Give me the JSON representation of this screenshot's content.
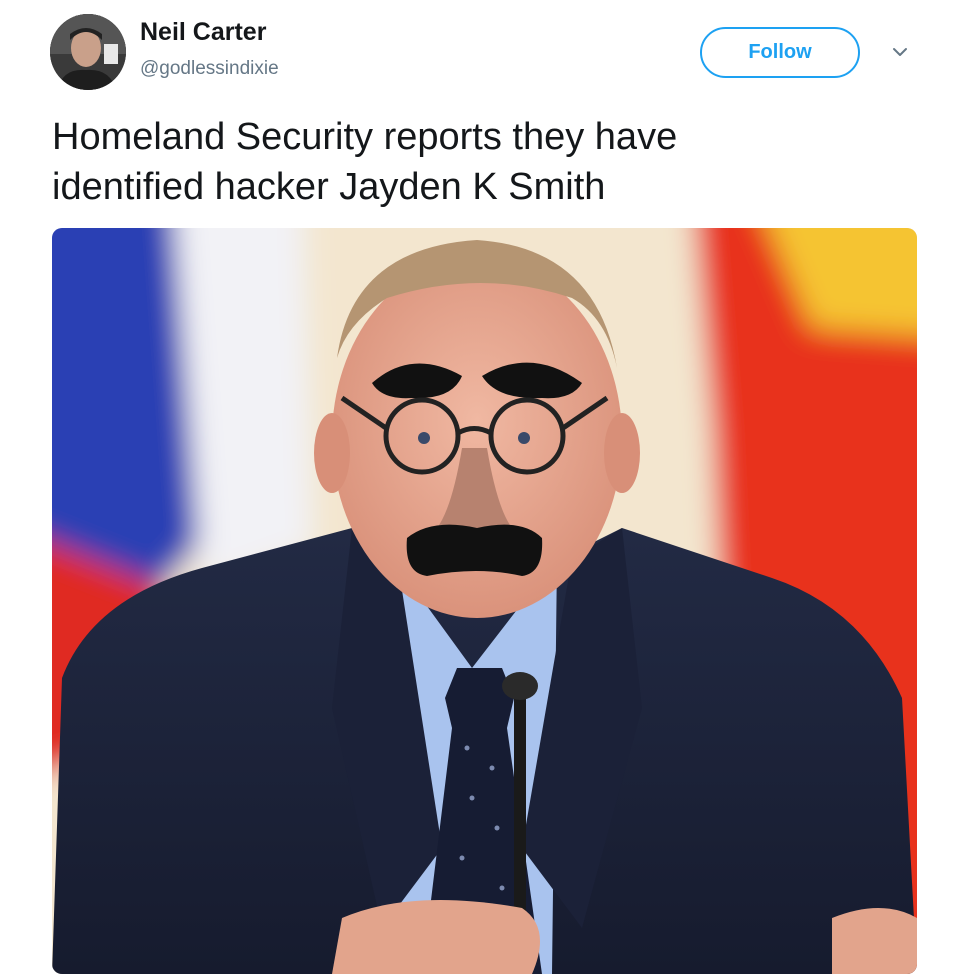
{
  "author": {
    "display_name": "Neil Carter",
    "handle": "@godlessindixie",
    "avatar_icon": "user-avatar"
  },
  "actions": {
    "follow_label": "Follow",
    "menu_icon": "chevron-down-icon"
  },
  "tweet": {
    "text_lines": [
      "Homeland Security reports they have",
      "identified hacker Jayden K Smith"
    ]
  },
  "colors": {
    "accent": "#1da1f2",
    "text": "#14171a",
    "secondary_text": "#657786"
  }
}
